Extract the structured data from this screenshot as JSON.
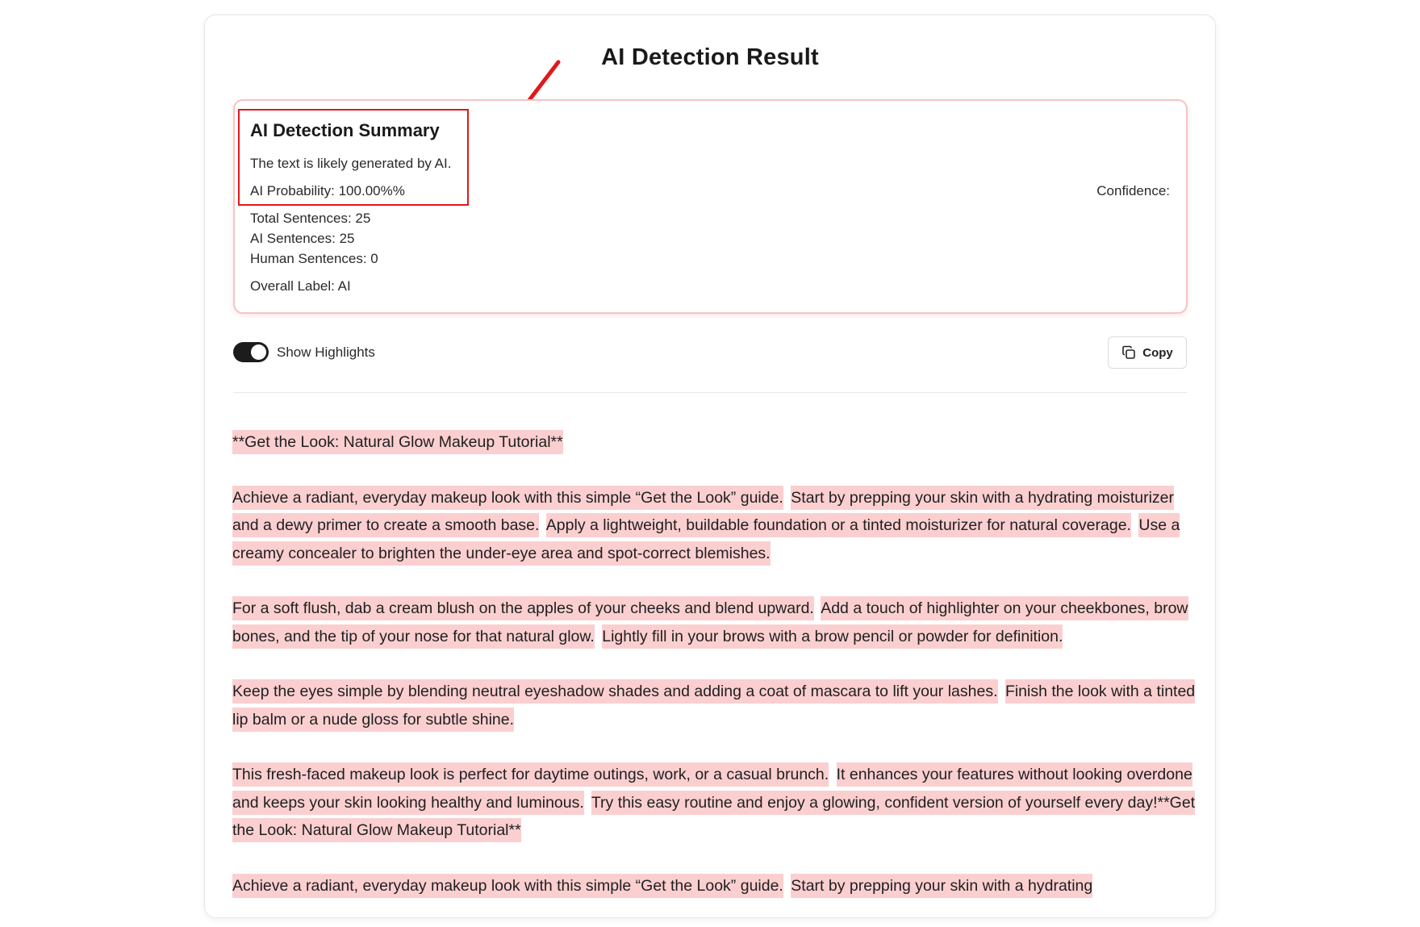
{
  "page": {
    "title": "AI Detection Result"
  },
  "summary": {
    "title": "AI Detection Summary",
    "verdict": "The text is likely generated by AI.",
    "probability": "AI Probability: 100.00%%",
    "total_sentences": "Total Sentences: 25",
    "ai_sentences": "AI Sentences: 25",
    "human_sentences": "Human Sentences: 0",
    "overall_label": "Overall Label: AI",
    "confidence_label": "Confidence:"
  },
  "controls": {
    "highlight_toggle_label": "Show Highlights",
    "highlight_toggle_on": true,
    "copy_label": "Copy"
  },
  "colors": {
    "highlight": "#fbcfd0",
    "annotation_red": "#e0191b",
    "summary_border": "#f5c4c4",
    "toggle_on": "#1c1c1c"
  },
  "content": {
    "paragraphs": [
      [
        "**Get the Look: Natural Glow Makeup Tutorial**"
      ],
      [
        "Achieve a radiant, everyday makeup look with this simple “Get the Look” guide.",
        "Start by prepping your skin with a hydrating moisturizer and a dewy primer to create a smooth base.",
        "Apply a lightweight, buildable foundation or a tinted moisturizer for natural coverage.",
        "Use a creamy concealer to brighten the under-eye area and spot-correct blemishes."
      ],
      [
        "For a soft flush, dab a cream blush on the apples of your cheeks and blend upward.",
        "Add a touch of highlighter on your cheekbones, brow bones, and the tip of your nose for that natural glow.",
        "Lightly fill in your brows with a brow pencil or powder for definition."
      ],
      [
        "Keep the eyes simple by blending neutral eyeshadow shades and adding a coat of mascara to lift your lashes.",
        "Finish the look with a tinted lip balm or a nude gloss for subtle shine."
      ],
      [
        "This fresh-faced makeup look is perfect for daytime outings, work, or a casual brunch.",
        "It enhances your features without looking overdone and keeps your skin looking healthy and luminous.",
        "Try this easy routine and enjoy a glowing, confident version of yourself every day!**Get the Look: Natural Glow Makeup Tutorial**"
      ],
      [
        "Achieve a radiant, everyday makeup look with this simple “Get the Look” guide.",
        "Start by prepping your skin with a hydrating"
      ]
    ]
  }
}
